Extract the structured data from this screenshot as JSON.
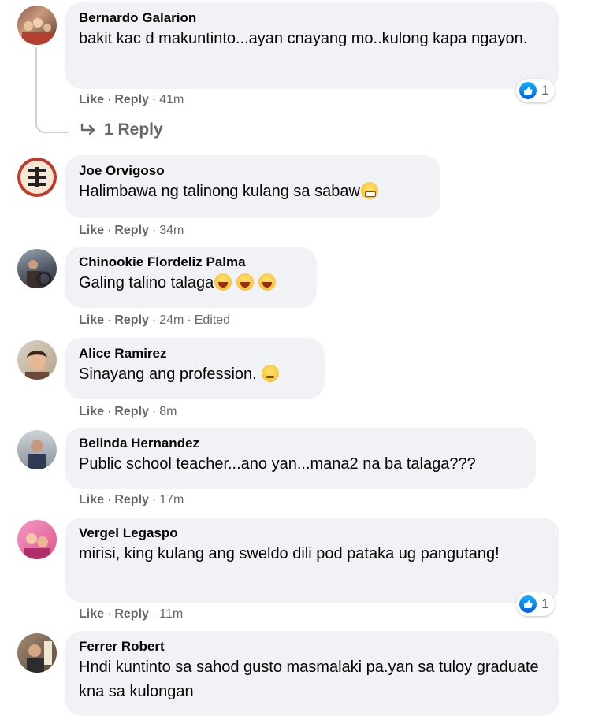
{
  "actions": {
    "like": "Like",
    "reply": "Reply",
    "edited": "Edited"
  },
  "replies_link": "1 Reply",
  "comments": [
    {
      "author": "Bernardo Galarion",
      "text": "bakit kac d makuntinto...ayan cnayang mo..kulong kapa ngayon.",
      "time": "41m",
      "reactions": "1"
    },
    {
      "author": "Joe Orvigoso",
      "text": "Halimbawa ng talinong kulang sa sabaw",
      "time": "34m",
      "emoji": "grin"
    },
    {
      "author": "Chinookie Flordeliz Palma",
      "text": "Galing talino talaga",
      "time": "24m",
      "emoji": "laugh"
    },
    {
      "author": "Alice Ramirez",
      "text": "Sinayang ang profession. ",
      "time": "8m",
      "emoji": "sad"
    },
    {
      "author": "Belinda Hernandez",
      "text": "Public school teacher...ano yan...mana2 na ba talaga???",
      "time": "17m"
    },
    {
      "author": "Vergel Legaspo",
      "text": "mirisi, king kulang ang sweldo dili pod pataka ug pangutang!",
      "time": "11m",
      "reactions": "1"
    },
    {
      "author": "Ferrer Robert",
      "text": "Hndi kuntinto sa sahod gusto masmalaki pa.yan sa tuloy graduate kna sa kulongan"
    }
  ]
}
